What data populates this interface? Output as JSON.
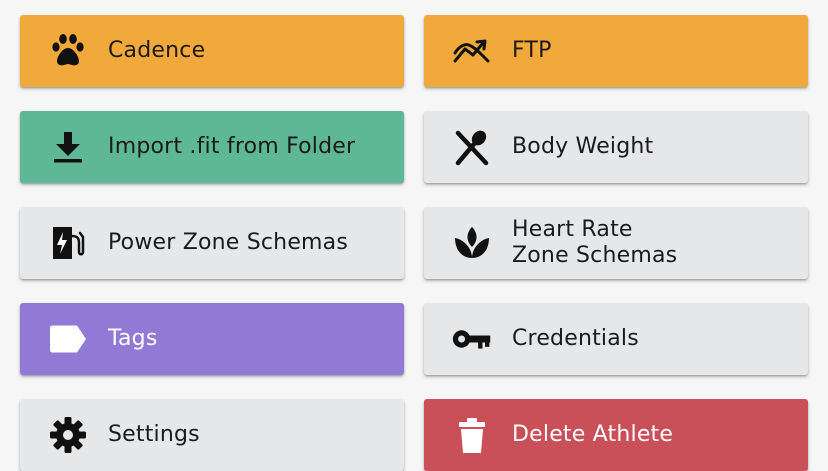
{
  "colors": {
    "orange": "#f2a93b",
    "green": "#5eb898",
    "gray": "#e6e7e9",
    "purple": "#9279d6",
    "red": "#c94f58",
    "page_bg": "#f6f6f7"
  },
  "tiles": [
    {
      "label": "Cadence",
      "icon": "paw-icon",
      "color": "orange"
    },
    {
      "label": "FTP",
      "icon": "trend-up-icon",
      "color": "orange"
    },
    {
      "label": "Import .fit from Folder",
      "icon": "download-icon",
      "color": "green"
    },
    {
      "label": "Body Weight",
      "icon": "utensils-icon",
      "color": "gray"
    },
    {
      "label": "Power Zone Schemas",
      "icon": "ev-charging-icon",
      "color": "gray"
    },
    {
      "label": "Heart Rate\nZone Schemas",
      "icon": "lotus-icon",
      "color": "gray"
    },
    {
      "label": "Tags",
      "icon": "tag-icon",
      "color": "purple"
    },
    {
      "label": "Credentials",
      "icon": "key-icon",
      "color": "gray"
    },
    {
      "label": "Settings",
      "icon": "gear-icon",
      "color": "gray"
    },
    {
      "label": "Delete Athlete",
      "icon": "trash-icon",
      "color": "red"
    }
  ]
}
